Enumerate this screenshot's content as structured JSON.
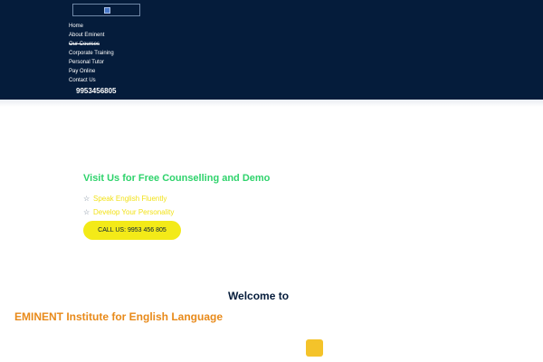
{
  "header": {
    "background": "#051c3b",
    "menu_toggle_icon": "hamburger-menu-icon",
    "nav_items": [
      {
        "label": "Home"
      },
      {
        "label": "About Eminent"
      },
      {
        "label": "Our Courses"
      },
      {
        "label": "Corporate Training"
      },
      {
        "label": "Personal Tutor"
      },
      {
        "label": "Pay Online"
      },
      {
        "label": "Contact Us"
      }
    ],
    "phone": "9953456805"
  },
  "hero": {
    "headline": "Visit Us for Free Counselling and Demo",
    "bullets": [
      {
        "icon": "star-outline-icon",
        "text": "Speak English Fluently"
      },
      {
        "icon": "star-outline-icon",
        "text": "Develop Your Personality"
      }
    ],
    "call_button_label": "CALL US: 9953 456 805"
  },
  "welcome": {
    "title": "Welcome to",
    "institute": "EMINENT Institute for English Language"
  },
  "scroll_top_icon": "scroll-to-top-icon",
  "colors": {
    "accent_green": "#2fd36c",
    "accent_yellow": "#f3ea18",
    "accent_orange": "#e88a1a",
    "navy": "#051c3b"
  }
}
